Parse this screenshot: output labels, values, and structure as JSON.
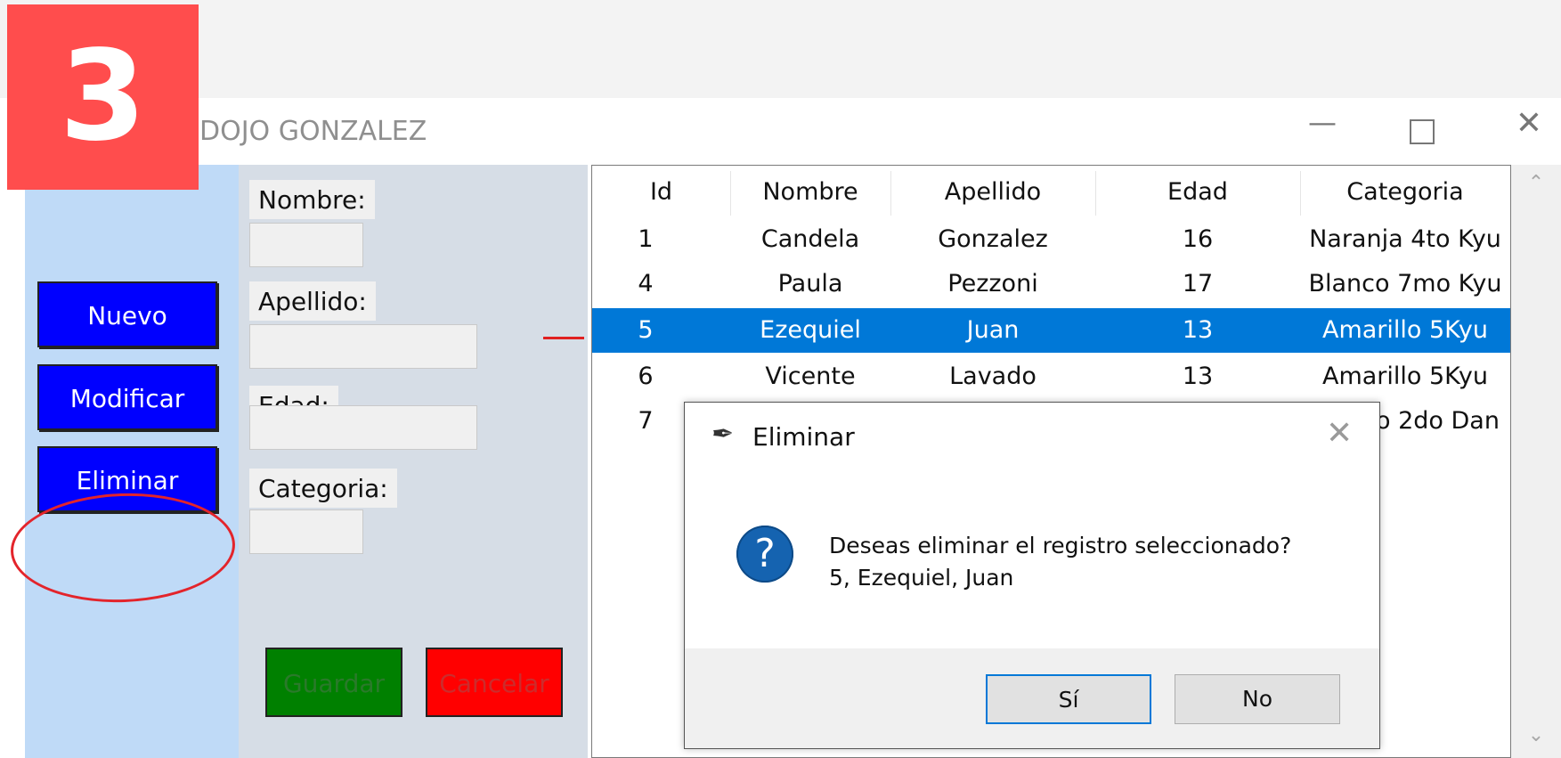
{
  "step_badge": "3",
  "window": {
    "title": "DOJO GONZALEZ",
    "minimize_glyph": "—",
    "close_glyph": "✕"
  },
  "left_panel": {
    "buttons": [
      {
        "label": "Nuevo"
      },
      {
        "label": "Modificar"
      },
      {
        "label": "Eliminar"
      }
    ]
  },
  "form": {
    "nombre_label": "Nombre:",
    "apellido_label": "Apellido:",
    "edad_label": "Edad:",
    "categoria_label": "Categoria:",
    "guardar_label": "Guardar",
    "cancelar_label": "Cancelar"
  },
  "table": {
    "columns": [
      "Id",
      "Nombre",
      "Apellido",
      "Edad",
      "Categoria"
    ],
    "rows": [
      {
        "id": "1",
        "nombre": "Candela",
        "apellido": "Gonzalez",
        "edad": "16",
        "categoria": "Naranja 4to Kyu"
      },
      {
        "id": "4",
        "nombre": "Paula",
        "apellido": "Pezzoni",
        "edad": "17",
        "categoria": "Blanco 7mo Kyu"
      },
      {
        "id": "5",
        "nombre": "Ezequiel",
        "apellido": "Juan",
        "edad": "13",
        "categoria": "Amarillo 5Kyu"
      },
      {
        "id": "6",
        "nombre": "Vicente",
        "apellido": "Lavado",
        "edad": "13",
        "categoria": "Amarillo 5Kyu"
      },
      {
        "id": "7",
        "nombre": "",
        "apellido": "",
        "edad": "",
        "categoria": "o 2do Dan"
      }
    ],
    "selected_row_index": 2
  },
  "dialog": {
    "title": "Eliminar",
    "message_line1": "Deseas eliminar el registro seleccionado?",
    "message_line2": "5, Ezequiel, Juan",
    "question_glyph": "?",
    "yes_label": "Sí",
    "no_label": "No",
    "close_glyph": "✕"
  },
  "colors": {
    "selection": "#0078d7",
    "action_button": "#0000ff",
    "guardar": "#008000",
    "cancelar": "#ff0000",
    "badge": "#ff4d4d",
    "annotation": "#e3242b"
  }
}
